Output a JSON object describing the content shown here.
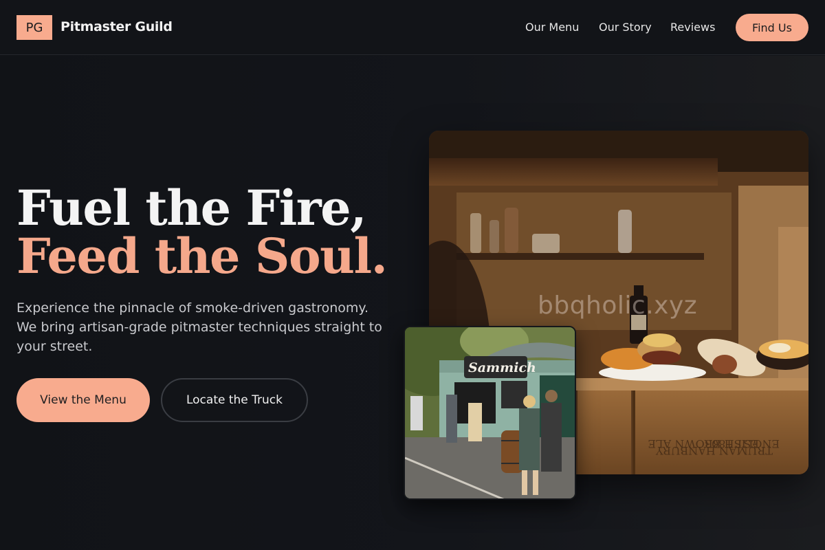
{
  "brand": {
    "logo_initials": "PG",
    "name": "Pitmaster Guild"
  },
  "nav": {
    "links": [
      "Our Menu",
      "Our Story",
      "Reviews"
    ],
    "cta_label": "Find Us"
  },
  "hero": {
    "headline_line1": "Fuel the Fire,",
    "headline_line2": "Feed the Soul.",
    "subcopy": "Experience the pinnacle of smoke-driven gastronomy. We bring artisan-grade pitmaster techniques straight to your street.",
    "primary_button": "View the Menu",
    "secondary_button": "Locate the Truck"
  },
  "images": {
    "main_photo_watermark": "bbqholic.xyz",
    "food_truck_sign": "Sammich"
  },
  "colors": {
    "accent": "#f8ab8e",
    "background": "#121418",
    "headline": "#f4f4f4",
    "headline_accent": "#f5a88b"
  }
}
